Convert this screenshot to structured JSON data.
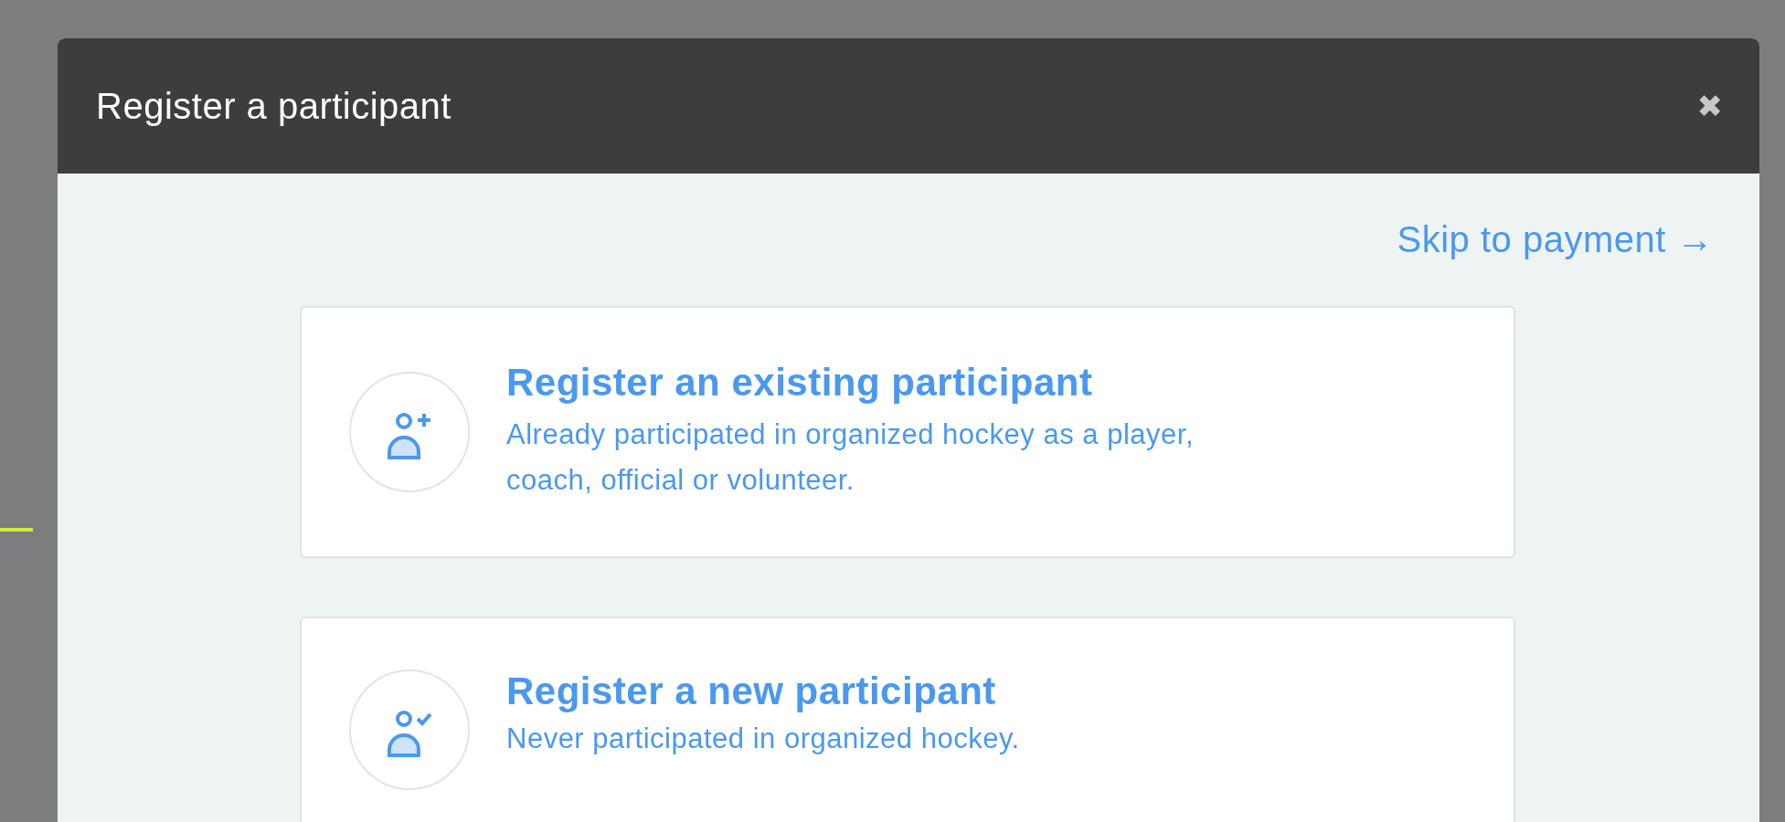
{
  "dialog": {
    "title": "Register a participant",
    "close_label": "✖"
  },
  "skip_link": {
    "label": "Skip to payment",
    "arrow": "→"
  },
  "options": [
    {
      "kind": "add",
      "title": "Register an existing participant",
      "description": "Already participated in organized hockey as a player, coach, official or volunteer."
    },
    {
      "kind": "check",
      "title": "Register a new participant",
      "description": "Never participated in organized hockey."
    }
  ]
}
